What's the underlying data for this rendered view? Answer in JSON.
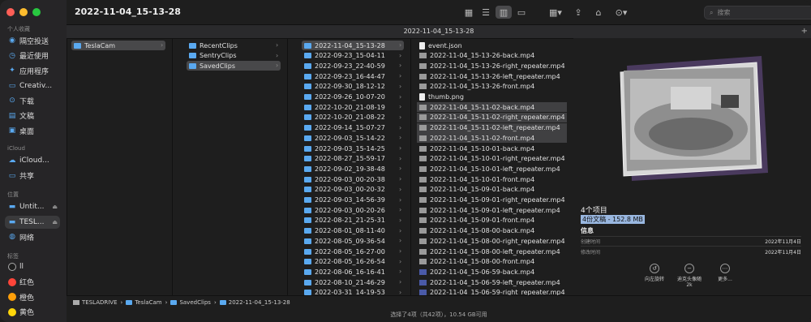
{
  "window": {
    "title": "2022-11-04_15-13-28"
  },
  "traffic": {
    "close": "#ff5f57",
    "min": "#febc2e",
    "max": "#28c840"
  },
  "sidebar": {
    "fav_title": "个人收藏",
    "favorites": [
      {
        "label": "隔空投送",
        "icon": "airdrop-icon"
      },
      {
        "label": "最近使用",
        "icon": "clock-icon"
      },
      {
        "label": "应用程序",
        "icon": "apps-icon"
      },
      {
        "label": "Creativ...",
        "icon": "folder-icon"
      },
      {
        "label": "下载",
        "icon": "download-icon"
      },
      {
        "label": "文稿",
        "icon": "document-icon"
      },
      {
        "label": "桌面",
        "icon": "desktop-icon"
      }
    ],
    "icloud_title": "iCloud",
    "icloud": [
      {
        "label": "iCloud...",
        "icon": "cloud-icon"
      },
      {
        "label": "共享",
        "icon": "shared-folder-icon"
      }
    ],
    "loc_title": "位置",
    "locations": [
      {
        "label": "Untit...",
        "icon": "drive-icon",
        "selected": false
      },
      {
        "label": "TESL...",
        "icon": "drive-icon",
        "selected": true
      },
      {
        "label": "网络",
        "icon": "network-icon",
        "selected": false
      }
    ],
    "tags_title": "标签",
    "tags": [
      {
        "label": "ll",
        "color": "#1e1e1e"
      },
      {
        "label": "红色",
        "color": "#ff453a"
      },
      {
        "label": "橙色",
        "color": "#ff9f0a"
      },
      {
        "label": "黄色",
        "color": "#ffd60a"
      }
    ]
  },
  "search": {
    "placeholder": "搜索"
  },
  "tab": {
    "label": "2022-11-04_15-13-28"
  },
  "col1": [
    "TeslaCam"
  ],
  "col2": [
    "RecentClips",
    "SentryClips",
    "SavedClips"
  ],
  "col3": [
    "2022-11-04_15-13-28",
    "2022-09-23_15-04-11",
    "2022-09-23_22-40-59",
    "2022-09-23_16-44-47",
    "2022-09-30_18-12-12",
    "2022-09-26_10-07-20",
    "2022-10-20_21-08-19",
    "2022-10-20_21-08-22",
    "2022-09-14_15-07-27",
    "2022-09-03_15-14-22",
    "2022-09-03_15-14-25",
    "2022-08-27_15-59-17",
    "2022-09-02_19-38-48",
    "2022-09-03_00-20-38",
    "2022-09-03_00-20-32",
    "2022-09-03_14-56-39",
    "2022-09-03_00-20-26",
    "2022-08-21_21-25-31",
    "2022-08-01_08-11-40",
    "2022-08-05_09-36-54",
    "2022-08-05_16-27-00",
    "2022-08-05_16-26-54",
    "2022-08-06_16-16-41",
    "2022-08-10_21-46-29",
    "2022-03-31_14-19-53"
  ],
  "col4": [
    "event.json",
    "2022-11-04_15-13-26-back.mp4",
    "2022-11-04_15-13-26-right_repeater.mp4",
    "2022-11-04_15-13-26-left_repeater.mp4",
    "2022-11-04_15-13-26-front.mp4",
    "thumb.png",
    "2022-11-04_15-11-02-back.mp4",
    "2022-11-04_15-11-02-right_repeater.mp4",
    "2022-11-04_15-11-02-left_repeater.mp4",
    "2022-11-04_15-11-02-front.mp4",
    "2022-11-04_15-10-01-back.mp4",
    "2022-11-04_15-10-01-right_repeater.mp4",
    "2022-11-04_15-10-01-left_repeater.mp4",
    "2022-11-04_15-10-01-front.mp4",
    "2022-11-04_15-09-01-back.mp4",
    "2022-11-04_15-09-01-right_repeater.mp4",
    "2022-11-04_15-09-01-left_repeater.mp4",
    "2022-11-04_15-09-01-front.mp4",
    "2022-11-04_15-08-00-back.mp4",
    "2022-11-04_15-08-00-right_repeater.mp4",
    "2022-11-04_15-08-00-left_repeater.mp4",
    "2022-11-04_15-08-00-front.mp4",
    "2022-11-04_15-06-59-back.mp4",
    "2022-11-04_15-06-59-left_repeater.mp4",
    "2022-11-04_15-06-59-right_repeater.mp4"
  ],
  "preview": {
    "count": "4个项目",
    "summary": "4份文稿 - 152.8 MB",
    "info_title": "信息",
    "created_label": "创建时间",
    "created_value": "2022年11月4日",
    "modified_label": "修改时间",
    "modified_value": "2022年11月4日",
    "actions": [
      {
        "label": "向左旋转",
        "sub": "",
        "icon": "rotate-left-icon"
      },
      {
        "label": "迪克头像随",
        "sub": "2k",
        "icon": "minus-circle-icon"
      },
      {
        "label": "更多...",
        "sub": "",
        "icon": "more-icon"
      }
    ]
  },
  "pathbar": [
    "TESLADRIVE",
    "TeslaCam",
    "SavedClips",
    "2022-11-04_15-13-28"
  ],
  "status": "选择了4项（共42项），10.54 GB可用"
}
